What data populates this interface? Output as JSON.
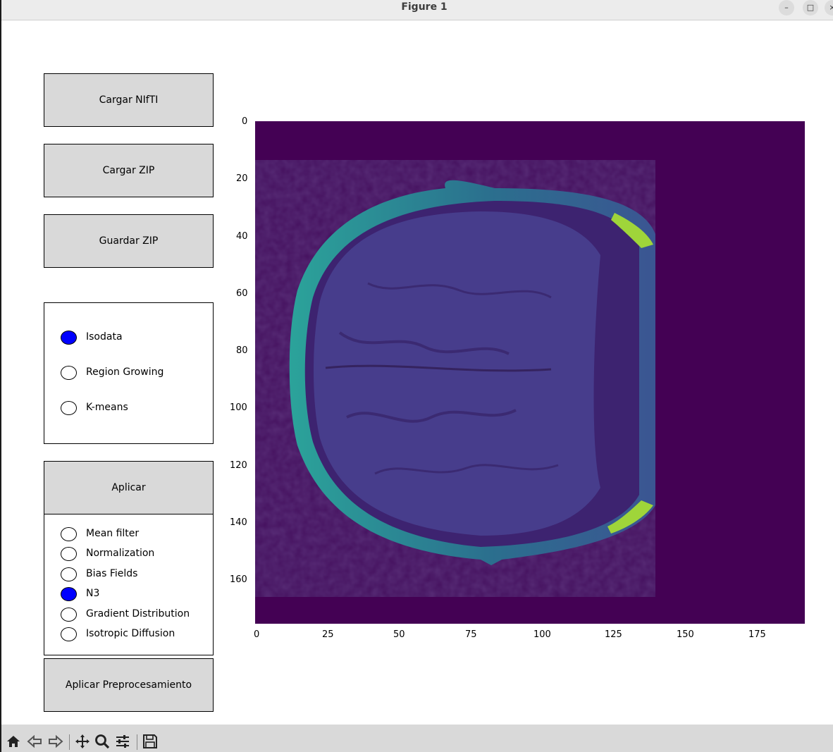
{
  "window": {
    "title": "Figure 1",
    "minimize_glyph": "–",
    "maximize_glyph": "□",
    "close_glyph": "×"
  },
  "buttons": {
    "load_nifti": "Cargar NIfTI",
    "load_zip": "Cargar ZIP",
    "save_zip": "Guardar ZIP",
    "apply": "Aplicar",
    "apply_preprocessing": "Aplicar Preprocesamiento"
  },
  "segmentation": {
    "options": [
      "Isodata",
      "Region Growing",
      "K-means"
    ],
    "selected": "Isodata"
  },
  "preprocessing": {
    "options": [
      "Mean filter",
      "Normalization",
      "Bias Fields",
      "N3",
      "Gradient Distribution",
      "Isotropic Diffusion"
    ],
    "selected": "N3"
  },
  "plot": {
    "x_ticks": [
      "0",
      "25",
      "50",
      "75",
      "100",
      "125",
      "150",
      "175"
    ],
    "y_ticks": [
      "0",
      "20",
      "40",
      "60",
      "80",
      "100",
      "120",
      "140",
      "160"
    ],
    "x_range": [
      0,
      192
    ],
    "y_range": [
      176,
      0
    ],
    "colormap": "viridis",
    "background_color": "#440154",
    "image_content": "axial MRI brain slice"
  },
  "toolbar": {
    "icons": [
      "home-icon",
      "back-icon",
      "forward-icon",
      "pan-icon",
      "zoom-icon",
      "configure-subplots-icon",
      "save-icon"
    ]
  },
  "colors": {
    "button_face": "#d9d9d9",
    "radio_selected": "#0000ff",
    "toolbar_bg": "#d9d9d9"
  }
}
